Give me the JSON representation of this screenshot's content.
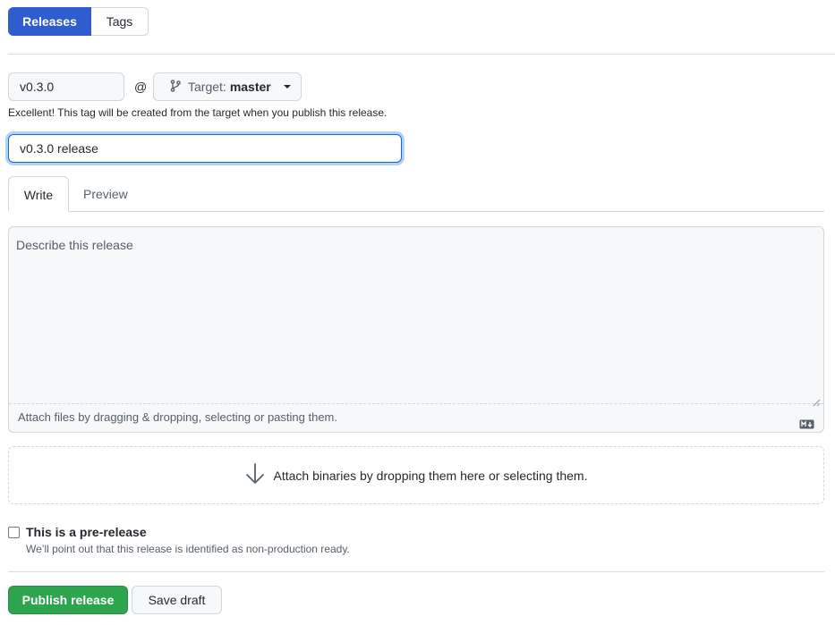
{
  "segmented": {
    "releases_label": "Releases",
    "tags_label": "Tags"
  },
  "tag": {
    "value": "v0.3.0",
    "at_symbol": "@",
    "target_prefix": "Target:",
    "target_branch": "master",
    "hint": "Excellent! This tag will be created from the target when you publish this release."
  },
  "title": {
    "value": "v0.3.0 release"
  },
  "tabs": {
    "write": "Write",
    "preview": "Preview"
  },
  "editor": {
    "placeholder": "Describe this release",
    "attach_hint": "Attach files by dragging & dropping, selecting or pasting them.",
    "markdown_icon": "markdown-icon"
  },
  "binaries": {
    "label": "Attach binaries by dropping them here or selecting them.",
    "icon": "arrow-down-icon"
  },
  "prerelease": {
    "checked": false,
    "label": "This is a pre-release",
    "description": "We’ll point out that this release is identified as non-production ready."
  },
  "actions": {
    "publish": "Publish release",
    "draft": "Save draft"
  },
  "colors": {
    "accent_blue": "#2f5dcf",
    "publish_green": "#2da44e",
    "focus_blue": "#0969da"
  }
}
